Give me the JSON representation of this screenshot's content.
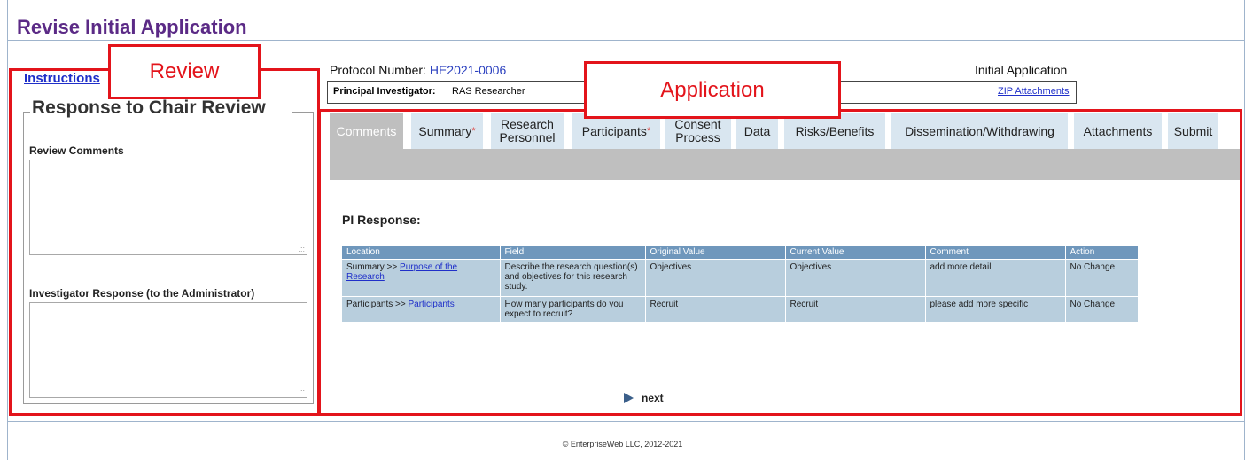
{
  "page": {
    "title": "Revise Initial Application"
  },
  "review_panel": {
    "instructions_link": "Instructions",
    "legend": "Response to Chair Review",
    "review_comments_label": "Review Comments",
    "investigator_response_label": "Investigator Response (to the Administrator)"
  },
  "protocol": {
    "number_label": "Protocol Number:",
    "number_value": "HE2021-0006",
    "application_type": "Initial Application",
    "pi_label": "Principal Investigator:",
    "pi_value": "RAS Researcher",
    "zip_link": "ZIP Attachments"
  },
  "tabs": [
    {
      "label": "Comments",
      "required": false
    },
    {
      "label": "Summary",
      "required": true
    },
    {
      "label": "Research Personnel",
      "required": false
    },
    {
      "label": "Participants",
      "required": true
    },
    {
      "label": "Consent Process",
      "required": false
    },
    {
      "label": "Data",
      "required": false
    },
    {
      "label": "Risks/Benefits",
      "required": false
    },
    {
      "label": "Dissemination/Withdrawing",
      "required": false
    },
    {
      "label": "Attachments",
      "required": false
    },
    {
      "label": "Submit",
      "required": false
    }
  ],
  "required_marker": "*",
  "pi_response": {
    "heading": "PI Response:",
    "columns": [
      "Location",
      "Field",
      "Original Value",
      "Current Value",
      "Comment",
      "Action"
    ],
    "rows": [
      {
        "location_prefix": "Summary >> ",
        "location_link": "Purpose of the Research",
        "field": "Describe the research question(s) and objectives for this research study.",
        "original": "Objectives",
        "current": "Objectives",
        "comment": "add more detail",
        "action": "No Change"
      },
      {
        "location_prefix": "Participants >> ",
        "location_link": "Participants",
        "field": "How many participants do you expect to recruit?",
        "original": "Recruit",
        "current": "Recruit",
        "comment": "please add more specific",
        "action": "No Change"
      }
    ]
  },
  "nav": {
    "next_label": "next"
  },
  "footer": {
    "copyright": "© EnterpriseWeb LLC, 2012-2021"
  },
  "annotations": {
    "review_label": "Review",
    "application_label": "Application",
    "color": "#e3141b"
  }
}
